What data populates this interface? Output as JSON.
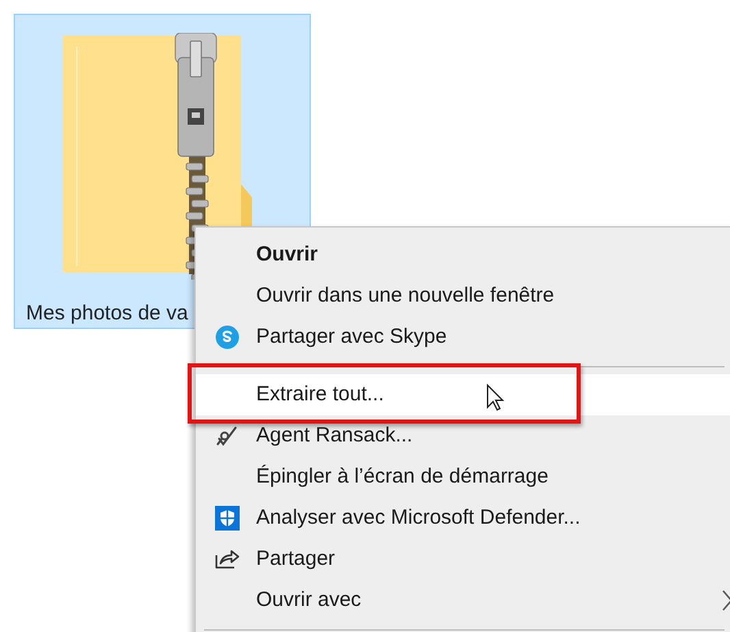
{
  "file_tile": {
    "label": "Mes photos de va",
    "selected": true
  },
  "context_menu": {
    "items": [
      {
        "kind": "item",
        "label": "Ouvrir",
        "bold": true,
        "selected": false,
        "outlined": false,
        "submenu": false
      },
      {
        "kind": "item",
        "label": "Ouvrir dans une nouvelle fenêtre",
        "bold": false,
        "selected": false,
        "outlined": false,
        "submenu": false
      },
      {
        "kind": "item",
        "label": "Partager avec Skype",
        "bold": false,
        "selected": false,
        "outlined": false,
        "submenu": false
      },
      {
        "kind": "separator"
      },
      {
        "kind": "item",
        "label": "Extraire tout...",
        "bold": false,
        "selected": true,
        "outlined": true,
        "submenu": false
      },
      {
        "kind": "item",
        "label": "Agent Ransack...",
        "bold": false,
        "selected": false,
        "outlined": false,
        "submenu": false
      },
      {
        "kind": "item",
        "label": "Épingler à l’écran de démarrage",
        "bold": false,
        "selected": false,
        "outlined": false,
        "submenu": false
      },
      {
        "kind": "item",
        "label": "Analyser avec Microsoft Defender...",
        "bold": false,
        "selected": false,
        "outlined": false,
        "submenu": false
      },
      {
        "kind": "item",
        "label": "Partager",
        "bold": false,
        "selected": false,
        "outlined": false,
        "submenu": false
      },
      {
        "kind": "item",
        "label": "Ouvrir avec",
        "bold": false,
        "selected": false,
        "outlined": false,
        "submenu": true
      },
      {
        "kind": "separator"
      }
    ]
  }
}
